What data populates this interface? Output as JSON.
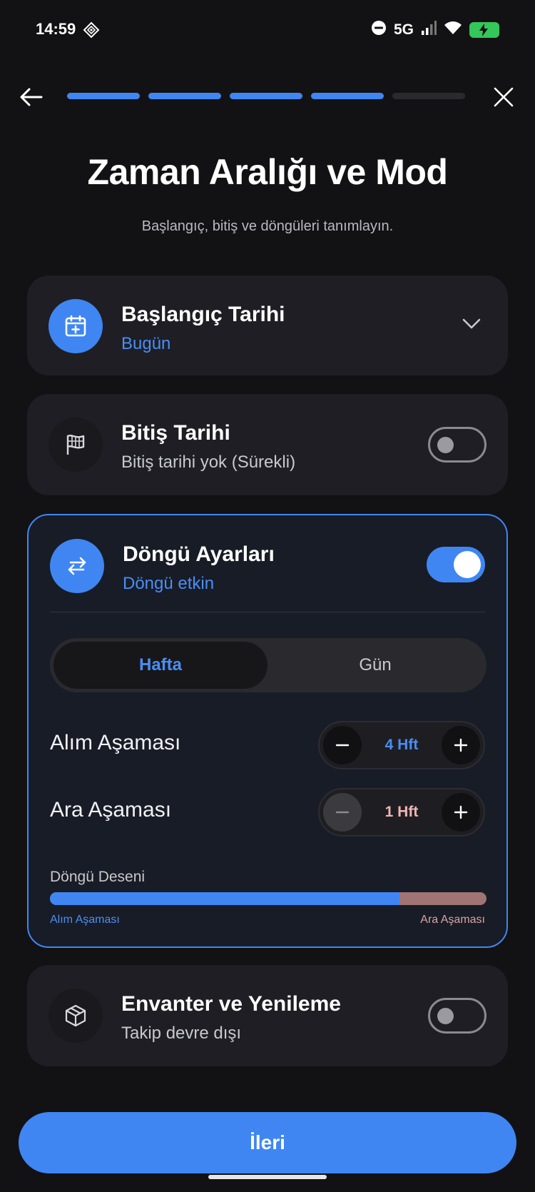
{
  "status_bar": {
    "time": "14:59",
    "network": "5G",
    "left_icon": "diamond-grid-icon",
    "right_icons": [
      "do-not-disturb-icon",
      "signal-icon",
      "wifi-icon",
      "battery-charging-icon"
    ]
  },
  "nav": {
    "back_icon": "arrow-left-icon",
    "close_icon": "close-icon",
    "progress": {
      "total_steps": 5,
      "completed_steps": 4
    }
  },
  "page": {
    "title": "Zaman Aralığı ve Mod",
    "subtitle": "Başlangıç, bitiş ve döngüleri tanımlayın."
  },
  "start_date": {
    "title": "Başlangıç Tarihi",
    "value": "Bugün",
    "icon": "calendar-add-icon"
  },
  "end_date": {
    "title": "Bitiş Tarihi",
    "value": "Bitiş tarihi yok (Sürekli)",
    "icon": "flag-icon",
    "enabled": false
  },
  "cycle": {
    "title": "Döngü Ayarları",
    "status": "Döngü etkin",
    "icon": "swap-arrows-icon",
    "enabled": true,
    "unit_options": [
      "Hafta",
      "Gün"
    ],
    "selected_unit": "Hafta",
    "intake_phase": {
      "label": "Alım Aşaması",
      "value": "4 Hft"
    },
    "break_phase": {
      "label": "Ara Aşaması",
      "value": "1 Hft"
    },
    "pattern": {
      "label": "Döngü Deseni",
      "intake_label": "Alım Aşaması",
      "break_label": "Ara Aşaması",
      "intake_fraction": 0.8
    },
    "colors": {
      "intake": "#3f86f2",
      "break": "#a07474"
    }
  },
  "inventory": {
    "title": "Envanter ve Yenileme",
    "status": "Takip devre dışı",
    "icon": "box-icon",
    "enabled": false
  },
  "footer": {
    "next_label": "İleri"
  },
  "colors": {
    "accent": "#3f86f2",
    "background": "#121214",
    "card": "#1e1e24"
  }
}
